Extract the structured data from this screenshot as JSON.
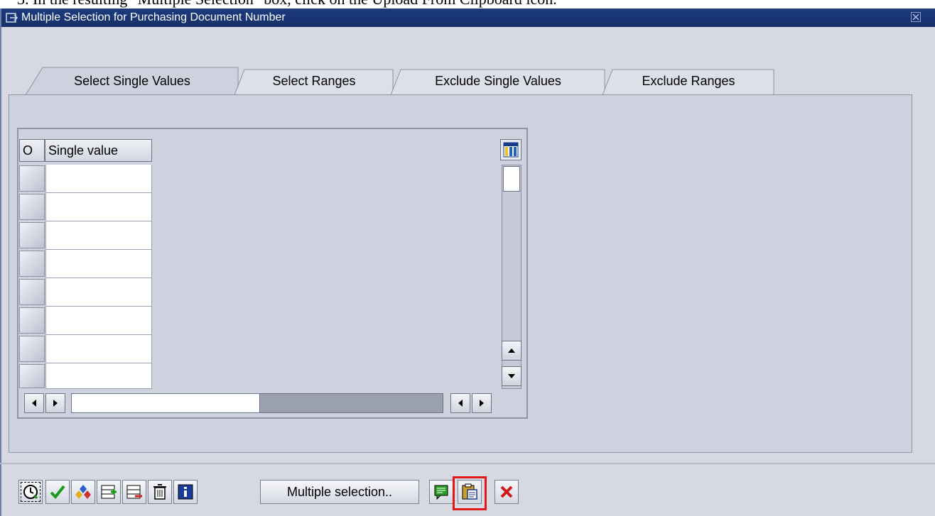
{
  "doc_instruction": "3.   In the resulting \"Multiple Selection\" box, click on the Upload From Clipboard icon.",
  "window": {
    "title": "Multiple Selection for Purchasing Document Number"
  },
  "tabs": [
    {
      "label": "Select Single Values",
      "active": true
    },
    {
      "label": "Select Ranges",
      "active": false
    },
    {
      "label": "Exclude Single Values",
      "active": false
    },
    {
      "label": "Exclude Ranges",
      "active": false
    }
  ],
  "table": {
    "columns": [
      "O",
      "Single value"
    ],
    "row_count": 8,
    "rows": [
      "",
      "",
      "",
      "",
      "",
      "",
      "",
      ""
    ]
  },
  "toolbar": {
    "multiple_selection_label": "Multiple selection..",
    "buttons": [
      "execute-icon",
      "checkmark-icon",
      "maintain-selection-icon",
      "insert-line-icon",
      "delete-line-icon",
      "trash-icon",
      "info-icon",
      "import-text-file-icon",
      "upload-from-clipboard-icon",
      "cancel-icon"
    ],
    "highlighted": "upload-from-clipboard-icon"
  },
  "colors": {
    "titlebar": "#1c3a7e",
    "panel": "#ced2de",
    "highlight": "#e21818"
  }
}
